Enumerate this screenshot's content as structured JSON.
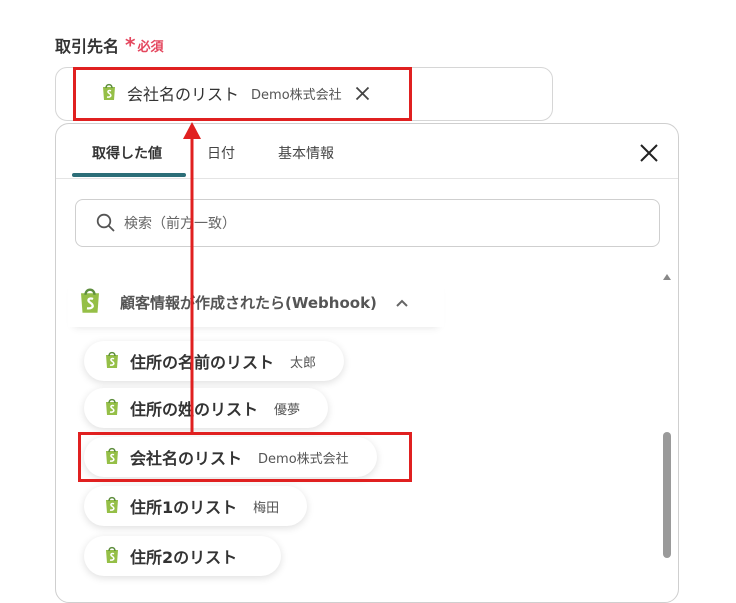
{
  "field": {
    "label": "取引先名",
    "required_mark": "*",
    "required_text": "必須"
  },
  "selected_chip": {
    "name": "会社名のリスト",
    "value": "Demo株式会社"
  },
  "panel": {
    "tabs": [
      {
        "label": "取得した値",
        "active": true
      },
      {
        "label": "日付",
        "active": false
      },
      {
        "label": "基本情報",
        "active": false
      }
    ],
    "search_placeholder": "検索（前方一致）",
    "group_title": "顧客情報が作成されたら(Webhook)",
    "items": [
      {
        "name": "住所の名前のリスト",
        "value": "太郎"
      },
      {
        "name": "住所の姓のリスト",
        "value": "優夢"
      },
      {
        "name": "会社名のリスト",
        "value": "Demo株式会社"
      },
      {
        "name": "住所1のリスト",
        "value": "梅田"
      },
      {
        "name": "住所2のリスト",
        "value": ""
      }
    ]
  },
  "colors": {
    "accent": "#2c6e78",
    "highlight": "#e02020",
    "required": "#e4475e",
    "shopify_green": "#95bf47"
  },
  "icons": {
    "app": "shopify-bag-icon",
    "close": "close-icon",
    "search": "search-icon",
    "chevron": "chevron-up-icon"
  }
}
